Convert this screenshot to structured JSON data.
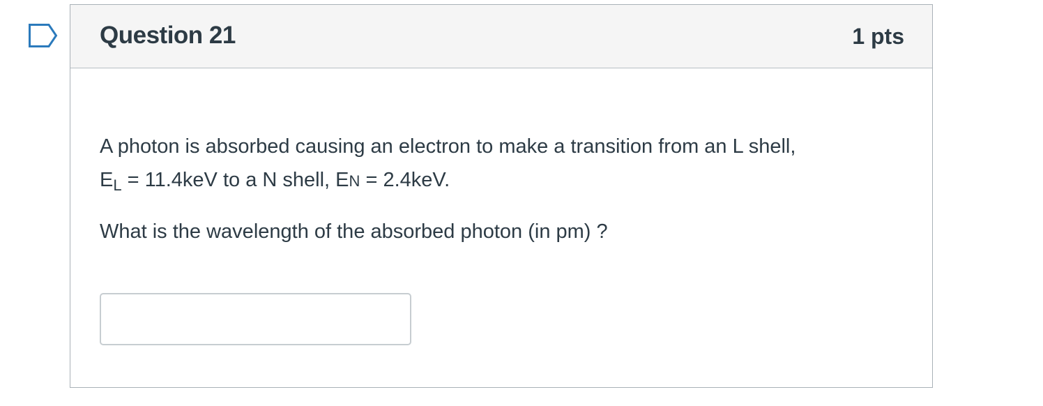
{
  "question": {
    "title": "Question 21",
    "points": "1 pts",
    "flag_icon": "bookmark-flag-icon",
    "body": {
      "line1": "A photon is absorbed causing an electron to  make a transition from an L shell,",
      "line2_prefix": "E",
      "line2_sub": "L",
      "line2_mid": " = 11.4keV to a N shell, E",
      "line2_small": "N",
      "line2_suffix": " = 2.4keV.",
      "prompt": "What is the wavelength of the absorbed photon (in pm) ?"
    },
    "answer": {
      "value": "",
      "placeholder": ""
    }
  },
  "colors": {
    "text": "#2d3b45",
    "header_bg": "#f5f5f5",
    "border": "#a9b1b7",
    "flag": "#2b7abc"
  }
}
